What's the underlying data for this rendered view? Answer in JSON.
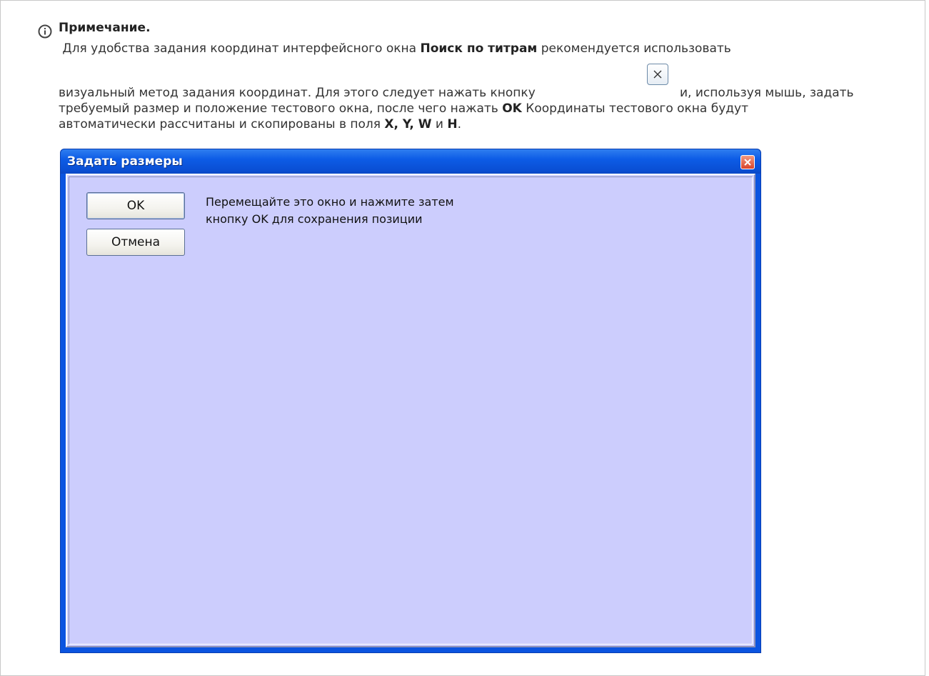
{
  "note": {
    "title": "Примечание.",
    "line1_pre": "Для удобства задания координат интерфейсного окна ",
    "line1_bold": "Поиск по титрам",
    "line1_post": " рекомендуется использовать",
    "line2_pre": "визуальный метод задания координат. Для этого следует нажать кнопку ",
    "line2_post": "и, используя мышь, задать",
    "line3_pre": "требуемый  размер и положение тестового окна, после чего нажать ",
    "line3_bold": "OK",
    "line3_post": "  Координаты тестового окна будут",
    "line4_pre": "автоматически рассчитаны и скопированы в поля  ",
    "line4_bold1": "X, Y, W",
    "line4_mid": " и ",
    "line4_bold2": "H",
    "line4_post": "."
  },
  "icons": {
    "info": "info-icon",
    "inline_button": "close-x-icon",
    "window_close": "close-icon"
  },
  "dialog": {
    "title": "Задать размеры",
    "ok_label": "OK",
    "cancel_label": "Отмена",
    "message_line1": "Перемещайте это окно и нажмите затем",
    "message_line2": "кнопку OK для сохранения позиции"
  },
  "colors": {
    "titlebar": "#0b54e0",
    "client_background": "#cccdfd",
    "close_button": "#d9442a"
  }
}
